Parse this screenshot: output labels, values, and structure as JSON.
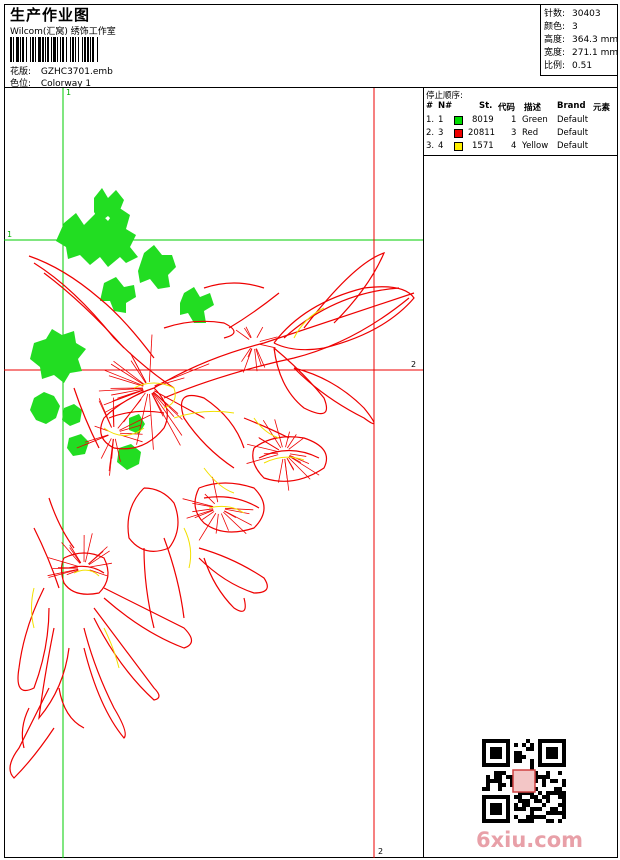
{
  "header": {
    "title": "生产作业图",
    "studio": "Wilcom(汇窝) 绣饰工作室",
    "design_label": "花版:",
    "design_value": "GZHC3701.emb",
    "color_label": "色位:",
    "color_value": "Colorway 1"
  },
  "stats": [
    {
      "label": "针数:",
      "value": "30403"
    },
    {
      "label": "颜色:",
      "value": "3"
    },
    {
      "label": "高度:",
      "value": "364.3 mm"
    },
    {
      "label": "宽度:",
      "value": "271.1 mm"
    },
    {
      "label": "比例:",
      "value": "0.51"
    }
  ],
  "sequence": {
    "title": "停止顺序:",
    "headers": {
      "num": "#",
      "n": "N#",
      "st": "St.",
      "code": "代码",
      "desc": "描述",
      "brand": "Brand",
      "element": "元素"
    },
    "rows": [
      {
        "num": "1.",
        "n": "1",
        "st": "8019",
        "code": "1",
        "desc": "Green",
        "brand": "Default",
        "color": "#00dd00"
      },
      {
        "num": "2.",
        "n": "3",
        "st": "20811",
        "code": "3",
        "desc": "Red",
        "brand": "Default",
        "color": "#ee0000"
      },
      {
        "num": "3.",
        "n": "4",
        "st": "1571",
        "code": "4",
        "desc": "Yellow",
        "brand": "Default",
        "color": "#ffee00"
      }
    ]
  },
  "guides": {
    "v1": "1",
    "h1": "1",
    "h2": "2",
    "v2": "2"
  },
  "watermark": "6xiu.com",
  "colors": {
    "guide_green": "#00cc00",
    "guide_red": "#ee0000"
  }
}
